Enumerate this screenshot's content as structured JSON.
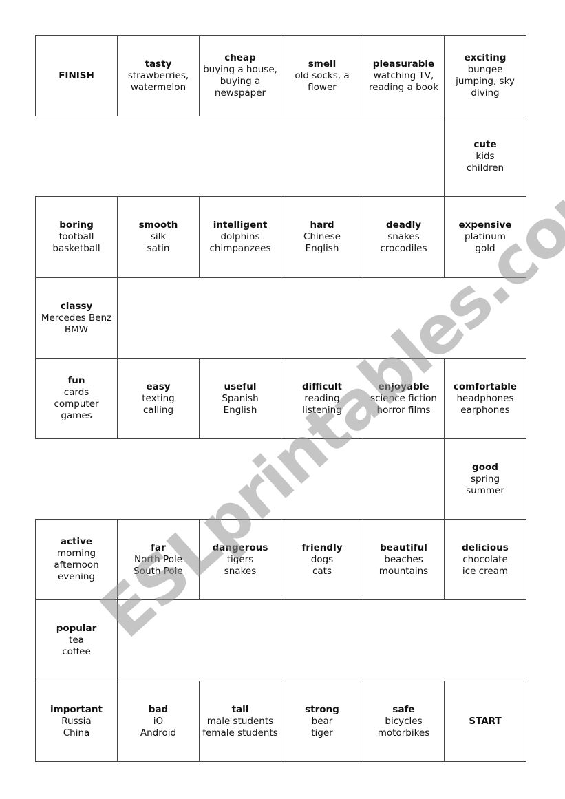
{
  "watermark": "ESLprintables.com",
  "board_rows": [
    [
      {
        "title": "FINISH",
        "lines": []
      },
      {
        "title": "tasty",
        "lines": [
          "strawberries,",
          "watermelon"
        ]
      },
      {
        "title": "cheap",
        "lines": [
          "buying a house,",
          "buying a",
          "newspaper"
        ]
      },
      {
        "title": "smell",
        "lines": [
          "old socks, a",
          "flower"
        ]
      },
      {
        "title": "pleasurable",
        "lines": [
          "watching TV,",
          "reading a book"
        ]
      },
      {
        "title": "exciting",
        "lines": [
          "bungee",
          "jumping, sky",
          "diving"
        ]
      }
    ],
    [
      {
        "title": "cute",
        "lines": [
          "kids",
          "children"
        ]
      }
    ],
    [
      {
        "title": "boring",
        "lines": [
          "football",
          "basketball"
        ]
      },
      {
        "title": "smooth",
        "lines": [
          "silk",
          "satin"
        ]
      },
      {
        "title": "intelligent",
        "lines": [
          "dolphins",
          "chimpanzees"
        ]
      },
      {
        "title": "hard",
        "lines": [
          "Chinese",
          "English"
        ]
      },
      {
        "title": "deadly",
        "lines": [
          "snakes",
          "crocodiles"
        ]
      },
      {
        "title": "expensive",
        "lines": [
          "platinum",
          "gold"
        ]
      }
    ],
    [
      {
        "title": "classy",
        "lines": [
          "Mercedes Benz",
          "BMW"
        ]
      }
    ],
    [
      {
        "title": "fun",
        "lines": [
          "cards",
          "computer",
          "games"
        ]
      },
      {
        "title": "easy",
        "lines": [
          "texting",
          "calling"
        ]
      },
      {
        "title": "useful",
        "lines": [
          "Spanish",
          "English"
        ]
      },
      {
        "title": "difficult",
        "lines": [
          "reading",
          "listening"
        ]
      },
      {
        "title": "enjoyable",
        "lines": [
          "science fiction",
          "horror films"
        ]
      },
      {
        "title": "comfortable",
        "lines": [
          "headphones",
          "earphones"
        ]
      }
    ],
    [
      {
        "title": "good",
        "lines": [
          "spring",
          "summer"
        ]
      }
    ],
    [
      {
        "title": "active",
        "lines": [
          "morning",
          "afternoon",
          "evening"
        ]
      },
      {
        "title": "far",
        "lines": [
          "North Pole",
          "South Pole"
        ]
      },
      {
        "title": "dangerous",
        "lines": [
          "tigers",
          "snakes"
        ]
      },
      {
        "title": "friendly",
        "lines": [
          "dogs",
          "cats"
        ]
      },
      {
        "title": "beautiful",
        "lines": [
          "beaches",
          "mountains"
        ]
      },
      {
        "title": "delicious",
        "lines": [
          "chocolate",
          "ice cream"
        ]
      }
    ],
    [
      {
        "title": "popular",
        "lines": [
          "tea",
          "coffee"
        ]
      }
    ],
    [
      {
        "title": "important",
        "lines": [
          "Russia",
          "China"
        ]
      },
      {
        "title": "bad",
        "lines": [
          "iO",
          "Android"
        ]
      },
      {
        "title": "tall",
        "lines": [
          "male students",
          "female students"
        ]
      },
      {
        "title": "strong",
        "lines": [
          "bear",
          "tiger"
        ]
      },
      {
        "title": "safe",
        "lines": [
          "bicycles",
          "motorbikes"
        ]
      },
      {
        "title": "START",
        "lines": []
      }
    ]
  ]
}
